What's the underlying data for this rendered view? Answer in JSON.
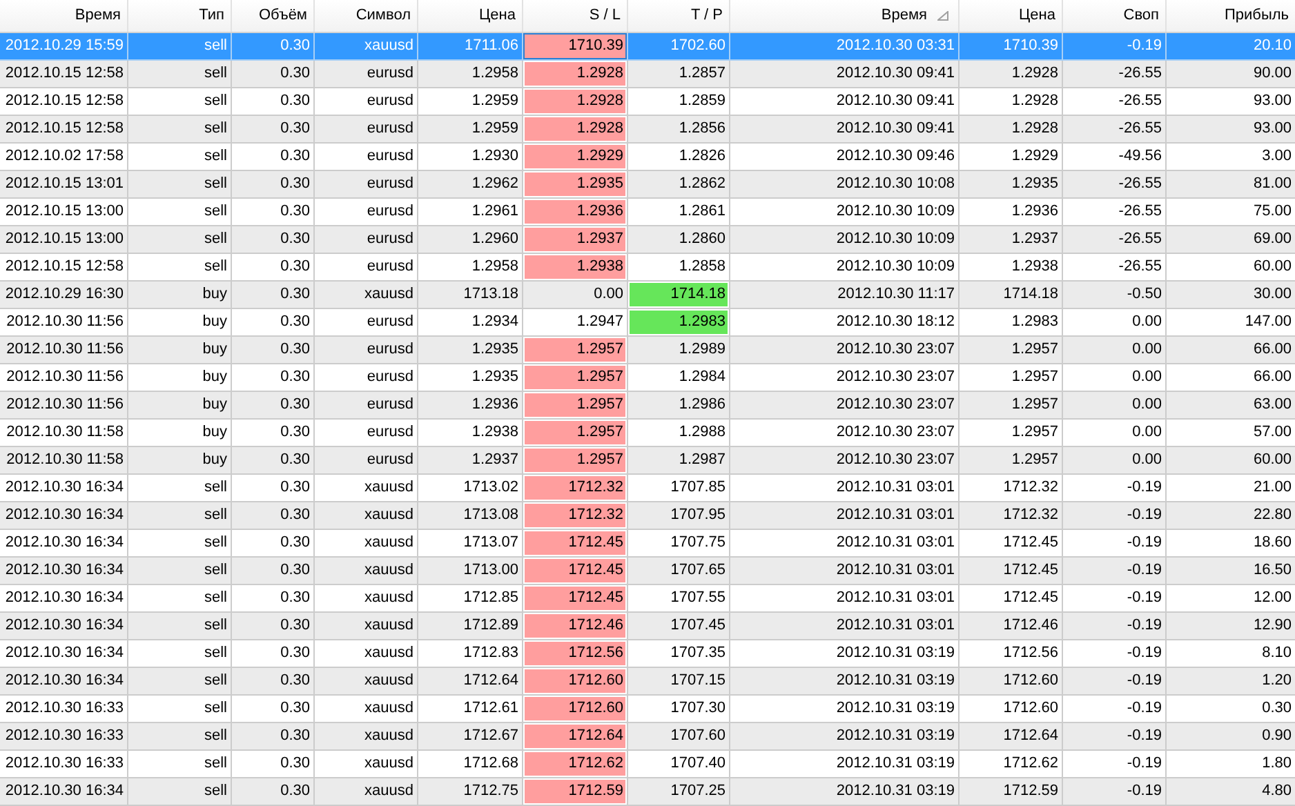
{
  "table": {
    "columns": [
      {
        "label": "Время",
        "sorted": false
      },
      {
        "label": "Тип",
        "sorted": false
      },
      {
        "label": "Объём",
        "sorted": false
      },
      {
        "label": "Символ",
        "sorted": false
      },
      {
        "label": "Цена",
        "sorted": false
      },
      {
        "label": "S / L",
        "sorted": false
      },
      {
        "label": "T / P",
        "sorted": false
      },
      {
        "label": "Время",
        "sorted": true
      },
      {
        "label": "Цена",
        "sorted": false
      },
      {
        "label": "Своп",
        "sorted": false
      },
      {
        "label": "Прибыль",
        "sorted": false
      }
    ],
    "rows": [
      {
        "selected": true,
        "sl_hit": true,
        "tp_hit": false,
        "cells": [
          "2012.10.29 15:59",
          "sell",
          "0.30",
          "xauusd",
          "1711.06",
          "1710.39",
          "1702.60",
          "2012.10.30 03:31",
          "1710.39",
          "-0.19",
          "20.10"
        ]
      },
      {
        "selected": false,
        "sl_hit": true,
        "tp_hit": false,
        "cells": [
          "2012.10.15 12:58",
          "sell",
          "0.30",
          "eurusd",
          "1.2958",
          "1.2928",
          "1.2857",
          "2012.10.30 09:41",
          "1.2928",
          "-26.55",
          "90.00"
        ]
      },
      {
        "selected": false,
        "sl_hit": true,
        "tp_hit": false,
        "cells": [
          "2012.10.15 12:58",
          "sell",
          "0.30",
          "eurusd",
          "1.2959",
          "1.2928",
          "1.2859",
          "2012.10.30 09:41",
          "1.2928",
          "-26.55",
          "93.00"
        ]
      },
      {
        "selected": false,
        "sl_hit": true,
        "tp_hit": false,
        "cells": [
          "2012.10.15 12:58",
          "sell",
          "0.30",
          "eurusd",
          "1.2959",
          "1.2928",
          "1.2856",
          "2012.10.30 09:41",
          "1.2928",
          "-26.55",
          "93.00"
        ]
      },
      {
        "selected": false,
        "sl_hit": true,
        "tp_hit": false,
        "cells": [
          "2012.10.02 17:58",
          "sell",
          "0.30",
          "eurusd",
          "1.2930",
          "1.2929",
          "1.2826",
          "2012.10.30 09:46",
          "1.2929",
          "-49.56",
          "3.00"
        ]
      },
      {
        "selected": false,
        "sl_hit": true,
        "tp_hit": false,
        "cells": [
          "2012.10.15 13:01",
          "sell",
          "0.30",
          "eurusd",
          "1.2962",
          "1.2935",
          "1.2862",
          "2012.10.30 10:08",
          "1.2935",
          "-26.55",
          "81.00"
        ]
      },
      {
        "selected": false,
        "sl_hit": true,
        "tp_hit": false,
        "cells": [
          "2012.10.15 13:00",
          "sell",
          "0.30",
          "eurusd",
          "1.2961",
          "1.2936",
          "1.2861",
          "2012.10.30 10:09",
          "1.2936",
          "-26.55",
          "75.00"
        ]
      },
      {
        "selected": false,
        "sl_hit": true,
        "tp_hit": false,
        "cells": [
          "2012.10.15 13:00",
          "sell",
          "0.30",
          "eurusd",
          "1.2960",
          "1.2937",
          "1.2860",
          "2012.10.30 10:09",
          "1.2937",
          "-26.55",
          "69.00"
        ]
      },
      {
        "selected": false,
        "sl_hit": true,
        "tp_hit": false,
        "cells": [
          "2012.10.15 12:58",
          "sell",
          "0.30",
          "eurusd",
          "1.2958",
          "1.2938",
          "1.2858",
          "2012.10.30 10:09",
          "1.2938",
          "-26.55",
          "60.00"
        ]
      },
      {
        "selected": false,
        "sl_hit": false,
        "tp_hit": true,
        "cells": [
          "2012.10.29 16:30",
          "buy",
          "0.30",
          "xauusd",
          "1713.18",
          "0.00",
          "1714.18",
          "2012.10.30 11:17",
          "1714.18",
          "-0.50",
          "30.00"
        ]
      },
      {
        "selected": false,
        "sl_hit": false,
        "tp_hit": true,
        "cells": [
          "2012.10.30 11:56",
          "buy",
          "0.30",
          "eurusd",
          "1.2934",
          "1.2947",
          "1.2983",
          "2012.10.30 18:12",
          "1.2983",
          "0.00",
          "147.00"
        ]
      },
      {
        "selected": false,
        "sl_hit": true,
        "tp_hit": false,
        "cells": [
          "2012.10.30 11:56",
          "buy",
          "0.30",
          "eurusd",
          "1.2935",
          "1.2957",
          "1.2989",
          "2012.10.30 23:07",
          "1.2957",
          "0.00",
          "66.00"
        ]
      },
      {
        "selected": false,
        "sl_hit": true,
        "tp_hit": false,
        "cells": [
          "2012.10.30 11:56",
          "buy",
          "0.30",
          "eurusd",
          "1.2935",
          "1.2957",
          "1.2984",
          "2012.10.30 23:07",
          "1.2957",
          "0.00",
          "66.00"
        ]
      },
      {
        "selected": false,
        "sl_hit": true,
        "tp_hit": false,
        "cells": [
          "2012.10.30 11:56",
          "buy",
          "0.30",
          "eurusd",
          "1.2936",
          "1.2957",
          "1.2986",
          "2012.10.30 23:07",
          "1.2957",
          "0.00",
          "63.00"
        ]
      },
      {
        "selected": false,
        "sl_hit": true,
        "tp_hit": false,
        "cells": [
          "2012.10.30 11:58",
          "buy",
          "0.30",
          "eurusd",
          "1.2938",
          "1.2957",
          "1.2988",
          "2012.10.30 23:07",
          "1.2957",
          "0.00",
          "57.00"
        ]
      },
      {
        "selected": false,
        "sl_hit": true,
        "tp_hit": false,
        "cells": [
          "2012.10.30 11:58",
          "buy",
          "0.30",
          "eurusd",
          "1.2937",
          "1.2957",
          "1.2987",
          "2012.10.30 23:07",
          "1.2957",
          "0.00",
          "60.00"
        ]
      },
      {
        "selected": false,
        "sl_hit": true,
        "tp_hit": false,
        "cells": [
          "2012.10.30 16:34",
          "sell",
          "0.30",
          "xauusd",
          "1713.02",
          "1712.32",
          "1707.85",
          "2012.10.31 03:01",
          "1712.32",
          "-0.19",
          "21.00"
        ]
      },
      {
        "selected": false,
        "sl_hit": true,
        "tp_hit": false,
        "cells": [
          "2012.10.30 16:34",
          "sell",
          "0.30",
          "xauusd",
          "1713.08",
          "1712.32",
          "1707.95",
          "2012.10.31 03:01",
          "1712.32",
          "-0.19",
          "22.80"
        ]
      },
      {
        "selected": false,
        "sl_hit": true,
        "tp_hit": false,
        "cells": [
          "2012.10.30 16:34",
          "sell",
          "0.30",
          "xauusd",
          "1713.07",
          "1712.45",
          "1707.75",
          "2012.10.31 03:01",
          "1712.45",
          "-0.19",
          "18.60"
        ]
      },
      {
        "selected": false,
        "sl_hit": true,
        "tp_hit": false,
        "cells": [
          "2012.10.30 16:34",
          "sell",
          "0.30",
          "xauusd",
          "1713.00",
          "1712.45",
          "1707.65",
          "2012.10.31 03:01",
          "1712.45",
          "-0.19",
          "16.50"
        ]
      },
      {
        "selected": false,
        "sl_hit": true,
        "tp_hit": false,
        "cells": [
          "2012.10.30 16:34",
          "sell",
          "0.30",
          "xauusd",
          "1712.85",
          "1712.45",
          "1707.55",
          "2012.10.31 03:01",
          "1712.45",
          "-0.19",
          "12.00"
        ]
      },
      {
        "selected": false,
        "sl_hit": true,
        "tp_hit": false,
        "cells": [
          "2012.10.30 16:34",
          "sell",
          "0.30",
          "xauusd",
          "1712.89",
          "1712.46",
          "1707.45",
          "2012.10.31 03:01",
          "1712.46",
          "-0.19",
          "12.90"
        ]
      },
      {
        "selected": false,
        "sl_hit": true,
        "tp_hit": false,
        "cells": [
          "2012.10.30 16:34",
          "sell",
          "0.30",
          "xauusd",
          "1712.83",
          "1712.56",
          "1707.35",
          "2012.10.31 03:19",
          "1712.56",
          "-0.19",
          "8.10"
        ]
      },
      {
        "selected": false,
        "sl_hit": true,
        "tp_hit": false,
        "cells": [
          "2012.10.30 16:34",
          "sell",
          "0.30",
          "xauusd",
          "1712.64",
          "1712.60",
          "1707.15",
          "2012.10.31 03:19",
          "1712.60",
          "-0.19",
          "1.20"
        ]
      },
      {
        "selected": false,
        "sl_hit": true,
        "tp_hit": false,
        "cells": [
          "2012.10.30 16:33",
          "sell",
          "0.30",
          "xauusd",
          "1712.61",
          "1712.60",
          "1707.30",
          "2012.10.31 03:19",
          "1712.60",
          "-0.19",
          "0.30"
        ]
      },
      {
        "selected": false,
        "sl_hit": true,
        "tp_hit": false,
        "cells": [
          "2012.10.30 16:33",
          "sell",
          "0.30",
          "xauusd",
          "1712.67",
          "1712.64",
          "1707.60",
          "2012.10.31 03:19",
          "1712.64",
          "-0.19",
          "0.90"
        ]
      },
      {
        "selected": false,
        "sl_hit": true,
        "tp_hit": false,
        "cells": [
          "2012.10.30 16:33",
          "sell",
          "0.30",
          "xauusd",
          "1712.68",
          "1712.62",
          "1707.40",
          "2012.10.31 03:19",
          "1712.62",
          "-0.19",
          "1.80"
        ]
      },
      {
        "selected": false,
        "sl_hit": true,
        "tp_hit": false,
        "cells": [
          "2012.10.30 16:34",
          "sell",
          "0.30",
          "xauusd",
          "1712.75",
          "1712.59",
          "1707.25",
          "2012.10.31 03:19",
          "1712.59",
          "-0.19",
          "4.80"
        ]
      }
    ]
  }
}
